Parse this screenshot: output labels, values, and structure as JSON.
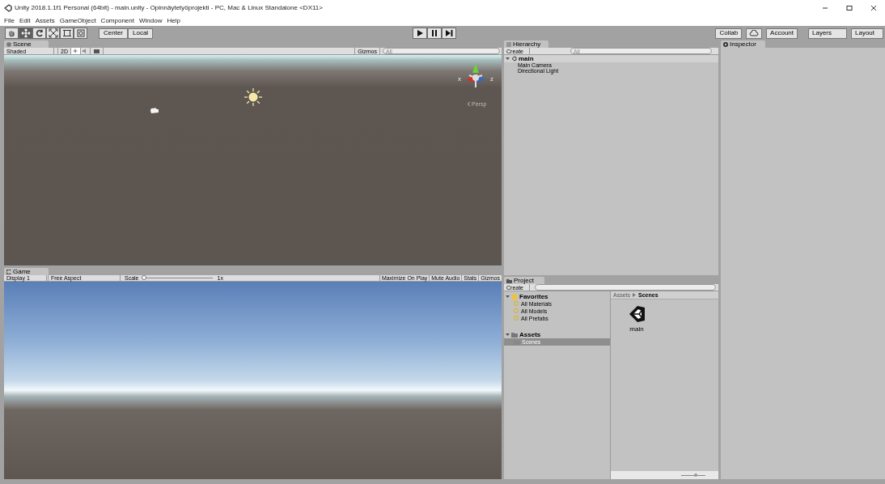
{
  "window": {
    "title": "Unity 2018.1.1f1 Personal (64bit) - main.unity - Opinnäytetyöprojekti - PC, Mac & Linux Standalone <DX11>"
  },
  "menu": [
    "File",
    "Edit",
    "Assets",
    "GameObject",
    "Component",
    "Window",
    "Help"
  ],
  "toolbar": {
    "tools": [
      {
        "kind": "hand",
        "selected": false
      },
      {
        "kind": "move",
        "selected": true
      },
      {
        "kind": "rotate",
        "selected": false
      },
      {
        "kind": "scale",
        "selected": false
      },
      {
        "kind": "rect",
        "selected": false
      },
      {
        "kind": "transform",
        "selected": false
      }
    ],
    "pivot": [
      "Center",
      "Local"
    ],
    "right": [
      "Collab",
      "Account",
      "Layers",
      "Layout"
    ]
  },
  "scene": {
    "tab": "Scene",
    "shading": "Shaded",
    "mode_2d": "2D",
    "view_toggles": [
      {
        "kind": "lighting",
        "on": true
      },
      {
        "kind": "audio",
        "on": false
      }
    ],
    "gizmos": "Gizmos",
    "search_placeholder": "All",
    "axes": [
      "x",
      "z"
    ],
    "persp": "Persp"
  },
  "game": {
    "tab": "Game",
    "display": "Display 1",
    "aspect": "Free Aspect",
    "scale_label": "Scale",
    "scale_value": "1x",
    "scale": {
      "level": 0
    },
    "toggles": [
      "Maximize On Play",
      "Mute Audio",
      "Stats",
      "Gizmos"
    ]
  },
  "hierarchy": {
    "tab": "Hierarchy",
    "create": "Create",
    "search_placeholder": "All",
    "scene": "main",
    "expanded": true,
    "children": [
      {
        "label": "Main Camera"
      },
      {
        "label": "Directional Light"
      }
    ]
  },
  "project": {
    "tab": "Project",
    "create": "Create",
    "tree": [
      {
        "label": "Favorites",
        "kind": "favorites",
        "expanded": true,
        "children": [
          {
            "label": "All Materials",
            "selected": false
          },
          {
            "label": "All Models",
            "selected": false
          },
          {
            "label": "All Prefabs",
            "selected": false
          }
        ]
      },
      {
        "label": "Assets",
        "kind": "folder",
        "expanded": true,
        "children": [
          {
            "label": "Scenes",
            "selected": true
          }
        ]
      }
    ],
    "breadcrumb": [
      "Assets",
      "Scenes"
    ],
    "icon_size": {
      "level": 0.6
    },
    "files": [
      {
        "name": "main"
      }
    ]
  },
  "inspector": {
    "tab": "Inspector"
  }
}
